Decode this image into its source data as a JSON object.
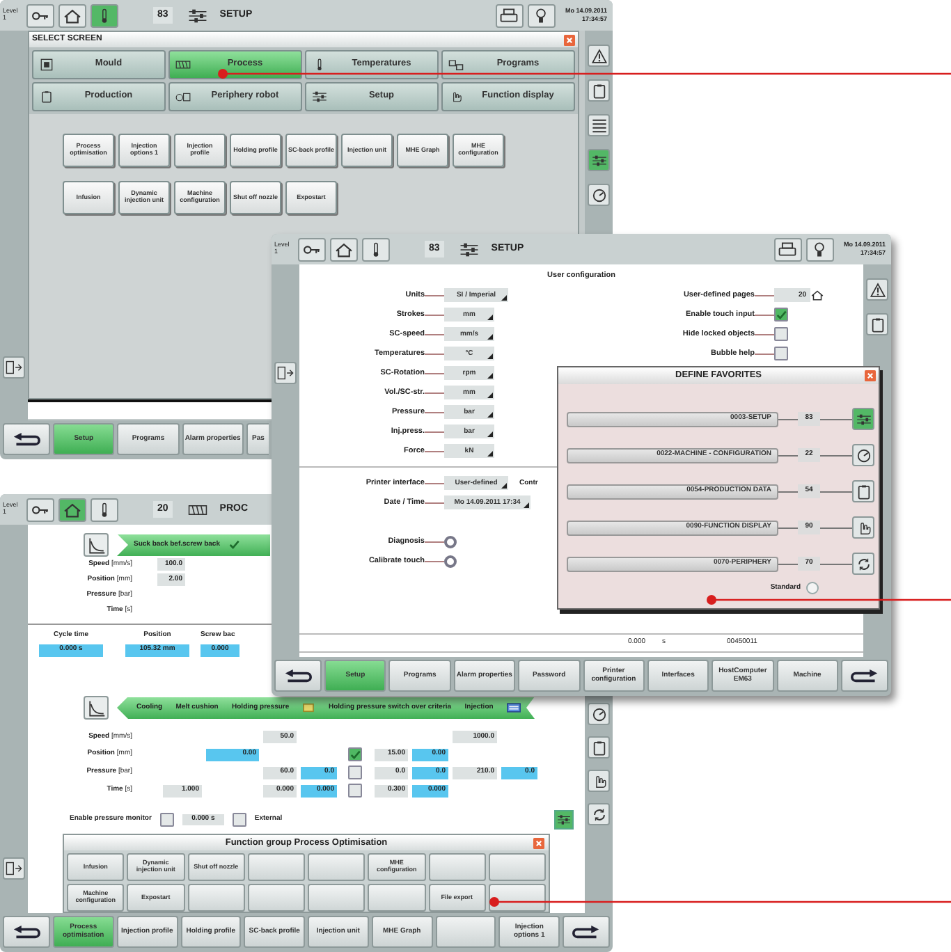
{
  "select_screen_window": {
    "header": {
      "level": "Level 1",
      "nav_tabs": [
        {
          "selected": false
        },
        {
          "selected": false
        },
        {
          "selected": true
        }
      ],
      "page_number": "83",
      "title": "SETUP",
      "date": "Mo 14.09.2011",
      "time": "17:34:57"
    },
    "side_tabs": [
      {
        "selected": false
      },
      {
        "selected": false
      },
      {
        "selected": false
      },
      {
        "selected": true
      },
      {
        "selected": false
      }
    ],
    "dialog": {
      "title": "SELECT SCREEN",
      "categories": [
        {
          "label": "Mould",
          "selected": false
        },
        {
          "label": "Process",
          "selected": true
        },
        {
          "label": "Temperatures",
          "selected": false
        },
        {
          "label": "Programs",
          "selected": false
        },
        {
          "label": "Production",
          "selected": false
        },
        {
          "label": "Periphery robot",
          "selected": false
        },
        {
          "label": "Setup",
          "selected": false
        },
        {
          "label": "Function display",
          "selected": false
        }
      ],
      "function_rows": [
        [
          "Process optimisation",
          "Injection options 1",
          "Injection profile",
          "Holding profile",
          "SC-back profile",
          "Injection unit",
          "MHE Graph",
          "MHE configuration"
        ],
        [
          "Infusion",
          "Dynamic injection unit",
          "Machine configuration",
          "Shut off nozzle",
          "Expostart"
        ]
      ]
    },
    "bottom_bar": [
      {
        "label": "Setup",
        "selected": true
      },
      {
        "label": "Programs",
        "selected": false
      },
      {
        "label": "Alarm properties",
        "selected": false
      },
      {
        "label": "Pas",
        "selected": false
      }
    ]
  },
  "setup_window": {
    "header": {
      "level": "Level 1",
      "nav_tabs": [
        {
          "selected": false
        },
        {
          "selected": false
        },
        {
          "selected": false
        }
      ],
      "page_number": "83",
      "title": "SETUP",
      "date": "Mo 14.09.2011",
      "time": "17:34:57"
    },
    "side_tabs": [
      {
        "selected": false
      },
      {
        "selected": false
      }
    ],
    "section_title": "User configuration",
    "units": [
      {
        "label": "Units",
        "value": "SI / Imperial"
      },
      {
        "label": "Strokes",
        "value": "mm"
      },
      {
        "label": "SC-speed",
        "value": "mm/s"
      },
      {
        "label": "Temperatures",
        "value": "°C"
      },
      {
        "label": "SC-Rotation",
        "value": "rpm"
      },
      {
        "label": "Vol./SC-str.",
        "value": "mm"
      },
      {
        "label": "Pressure",
        "value": "bar"
      },
      {
        "label": "Inj.press.",
        "value": "bar"
      },
      {
        "label": "Force",
        "value": "kN"
      }
    ],
    "options": [
      {
        "label": "User-defined pages",
        "kind": "number",
        "value": "20"
      },
      {
        "label": "Enable touch input",
        "kind": "checkbox",
        "checked": true
      },
      {
        "label": "Hide locked objects",
        "kind": "checkbox",
        "checked": false
      },
      {
        "label": "Bubble help",
        "kind": "checkbox",
        "checked": false
      }
    ],
    "interface_settings": [
      {
        "label": "Printer interface",
        "value": "User-defined"
      },
      {
        "label": "Date / Time",
        "value": "Mo 14.09.2011 17:34"
      }
    ],
    "actions": [
      "Diagnosis",
      "Calibrate touch"
    ],
    "controls_heading": "Contr",
    "status": [
      "0.000",
      "s",
      "00450011"
    ],
    "favorites": {
      "title": "DEFINE FAVORITES",
      "items": [
        {
          "label": "0003-SETUP",
          "number": "83",
          "selected": true
        },
        {
          "label": "0022-MACHINE - CONFIGURATION",
          "number": "22",
          "selected": false
        },
        {
          "label": "0054-PRODUCTION DATA",
          "number": "54",
          "selected": false
        },
        {
          "label": "0090-FUNCTION DISPLAY",
          "number": "90",
          "selected": false
        },
        {
          "label": "0070-PERIPHERY",
          "number": "70",
          "selected": false
        }
      ],
      "standard": "Standard",
      "standard_selected": false
    },
    "bottom_bar": [
      {
        "label": "Setup",
        "selected": true
      },
      {
        "label": "Programs",
        "selected": false
      },
      {
        "label": "Alarm properties",
        "selected": false
      },
      {
        "label": "Password",
        "selected": false
      },
      {
        "label": "Printer configuration",
        "selected": false
      },
      {
        "label": "Interfaces",
        "selected": false
      },
      {
        "label": "HostComputer EM63",
        "selected": false
      },
      {
        "label": "Machine",
        "selected": false
      }
    ]
  },
  "process_window": {
    "header": {
      "level": "Level 1",
      "nav_tabs": [
        {
          "selected": false
        },
        {
          "selected": true
        },
        {
          "selected": false
        }
      ],
      "page_number": "20",
      "title": "PROC"
    },
    "side_tabs": [
      {
        "selected": false
      },
      {
        "selected": false
      },
      {
        "selected": false
      },
      {
        "selected": false
      }
    ],
    "suck_back": "Suck back bef.screw back",
    "upper_rows": [
      {
        "label": "**Speed** [mm/s]",
        "value": "100.0"
      },
      {
        "label": "**Position** [mm]",
        "value": "2.00"
      },
      {
        "label": "**Pressure** [bar]"
      },
      {
        "label": "**Time** [s]"
      }
    ],
    "readouts": [
      {
        "label": "Cycle time",
        "value": "0.000 s"
      },
      {
        "label": "Position",
        "value": "105.32 mm"
      },
      {
        "label": "Screw bac",
        "value": "0.000"
      }
    ],
    "phases": [
      "Cooling",
      "Melt cushion",
      "Holding pressure",
      "Holding pressure switch over criteria",
      "Injection"
    ],
    "profile_rows": [
      {
        "label": "**Speed** [mm/s]",
        "cells": [
          {
            "kind": "empty"
          },
          {
            "kind": "empty"
          },
          {
            "kind": "input",
            "text": "50.0"
          },
          {
            "kind": "empty"
          },
          {
            "kind": "empty"
          },
          {
            "kind": "empty"
          },
          {
            "kind": "empty"
          },
          {
            "kind": "input",
            "text": "1000.0"
          },
          {
            "kind": "empty"
          }
        ]
      },
      {
        "label": "**Position** [mm]",
        "cells": [
          {
            "kind": "empty"
          },
          {
            "kind": "readout",
            "text": "0.00"
          },
          {
            "kind": "empty"
          },
          {
            "kind": "empty"
          },
          {
            "kind": "checkbox",
            "checked": true
          },
          {
            "kind": "input",
            "text": "15.00"
          },
          {
            "kind": "readout",
            "text": "0.00"
          },
          {
            "kind": "empty"
          },
          {
            "kind": "empty"
          }
        ]
      },
      {
        "label": "**Pressure** [bar]",
        "cells": [
          {
            "kind": "empty"
          },
          {
            "kind": "empty"
          },
          {
            "kind": "input",
            "text": "60.0"
          },
          {
            "kind": "readout",
            "text": "0.0"
          },
          {
            "kind": "checkbox",
            "checked": false
          },
          {
            "kind": "input",
            "text": "0.0"
          },
          {
            "kind": "readout",
            "text": "0.0"
          },
          {
            "kind": "input",
            "text": "210.0"
          },
          {
            "kind": "readout",
            "text": "0.0"
          }
        ]
      },
      {
        "label": "**Time** [s]",
        "cells": [
          {
            "kind": "input",
            "text": "1.000"
          },
          {
            "kind": "empty"
          },
          {
            "kind": "input",
            "text": "0.000"
          },
          {
            "kind": "readout",
            "text": "0.000"
          },
          {
            "kind": "checkbox",
            "checked": false
          },
          {
            "kind": "input",
            "text": "0.300"
          },
          {
            "kind": "readout",
            "text": "0.000"
          },
          {
            "kind": "empty"
          },
          {
            "kind": "empty"
          }
        ]
      }
    ],
    "monitor": {
      "label": "Enable pressure monitor",
      "checked": false,
      "time": "0.000 s",
      "external_checked": false,
      "external": "External"
    },
    "function_group": {
      "title": "Function group Process Optimisation",
      "rows": [
        [
          {
            "label": "Infusion"
          },
          {
            "label": "Dynamic injection unit"
          },
          {
            "label": "Shut off nozzle"
          },
          {},
          {},
          {
            "label": "MHE configuration"
          },
          {},
          {}
        ],
        [
          {
            "label": "Machine configuration"
          },
          {
            "label": "Expostart"
          },
          {},
          {},
          {},
          {},
          {
            "label": "File export"
          },
          {}
        ]
      ]
    },
    "bottom_bar": [
      {
        "label": "Process optimisation",
        "selected": true
      },
      {
        "label": "Injection profile",
        "selected": false
      },
      {
        "label": "Holding profile",
        "selected": false
      },
      {
        "label": "SC-back profile",
        "selected": false
      },
      {
        "label": "Injection unit",
        "selected": false
      },
      {
        "label": "MHE Graph",
        "selected": false
      },
      {
        "selected": false
      },
      {
        "label": "Injection options 1",
        "selected": false
      }
    ]
  }
}
